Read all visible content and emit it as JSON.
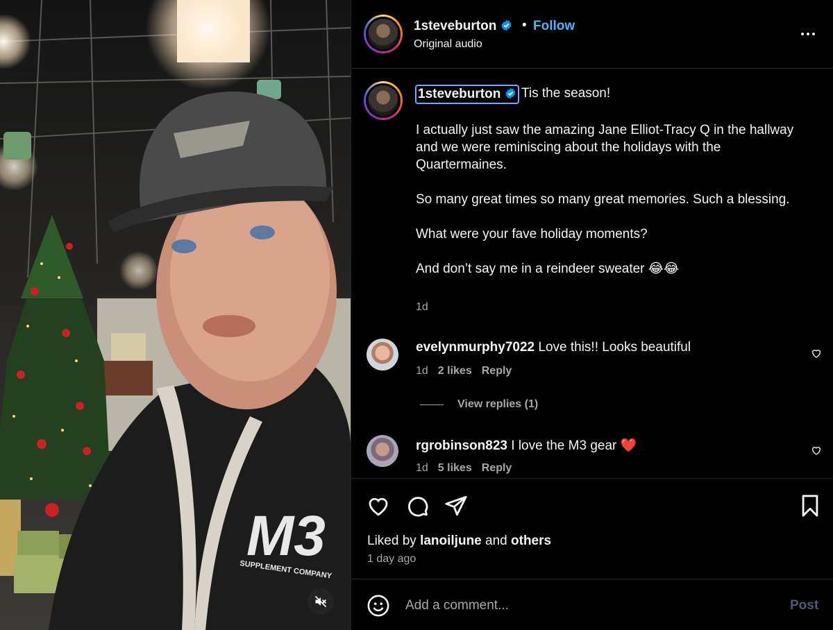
{
  "header": {
    "username": "1steveburton",
    "follow_label": "Follow",
    "separator": "•",
    "subtitle": "Original audio",
    "more_icon": "more-horizontal-icon"
  },
  "caption": {
    "username": "1steveburton",
    "first_line": "Tis the season!",
    "body": "I actually just saw the amazing Jane Elliot-Tracy Q in the hallway and we were reminiscing about the holidays with the Quartermaines.\n\nSo many great times so many great memories. Such a blessing.\n\nWhat were your fave holiday moments?\n\nAnd don’t say me in a reindeer sweater 😂😂",
    "time": "1d"
  },
  "comments": [
    {
      "username": "evelynmurphy7022",
      "text": "Love this!! Looks beautiful",
      "time": "1d",
      "likes": "2 likes",
      "reply": "Reply",
      "view_replies": "View replies (1)"
    },
    {
      "username": "rgrobinson823",
      "text": "I love the M3 gear ❤️",
      "time": "1d",
      "likes": "5 likes",
      "reply": "Reply"
    }
  ],
  "actions": {
    "liked_prefix": "Liked by",
    "liked_user": "lanoiljune",
    "liked_and": "and",
    "liked_others": "others",
    "timestamp": "1 day ago"
  },
  "comment_bar": {
    "placeholder": "Add a comment...",
    "post_label": "Post"
  },
  "video": {
    "shirt_logo": "M3",
    "shirt_sub": "SUPPLEMENT COMPANY"
  },
  "colors": {
    "background": "#000000",
    "link_blue": "#4cb5f9",
    "verified_blue": "#0095f6",
    "muted_text": "#a8a8a8",
    "post_disabled": "#4a5d78",
    "divider": "#262626"
  }
}
